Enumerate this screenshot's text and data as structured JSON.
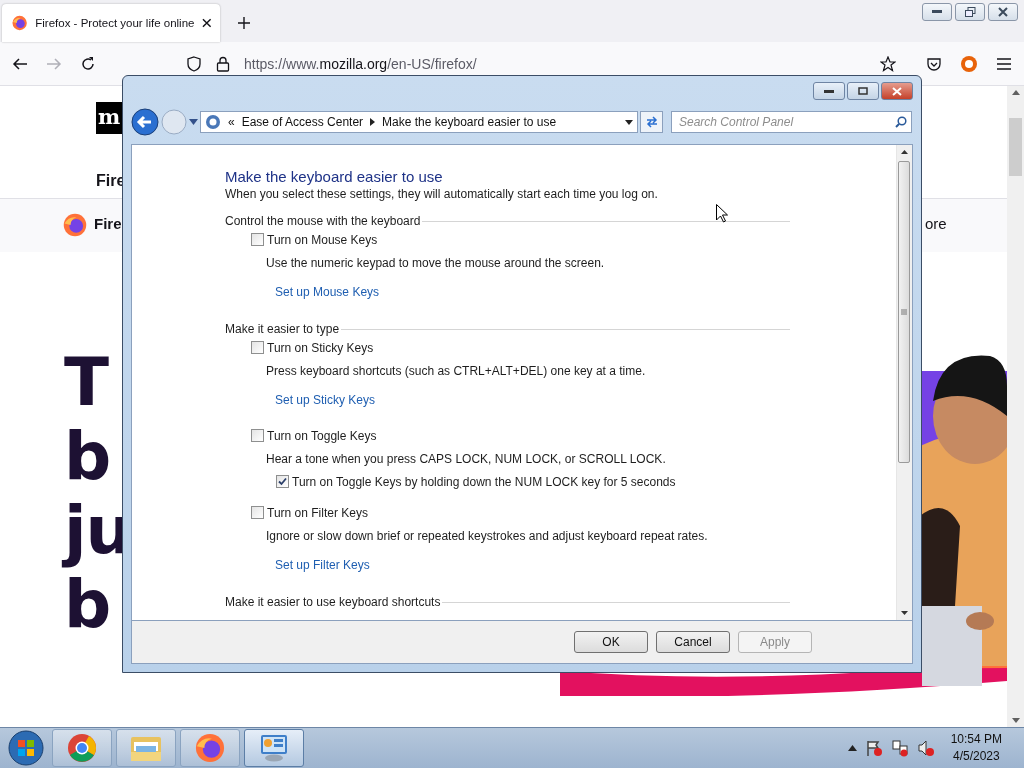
{
  "browser": {
    "tabs": [
      {
        "title": "Firefox - Protect your life online",
        "selected": true
      }
    ],
    "url_host": "https://www.",
    "url_domain": "mozilla.org",
    "url_path": "/en-US/firefox/"
  },
  "page": {
    "logo": "m",
    "nav_text": "Fire",
    "product_name": "Fire",
    "more_text": "ore",
    "headline": [
      "T",
      "b",
      "ju",
      "b"
    ]
  },
  "dialog": {
    "breadcrumb": [
      "«",
      "Ease of Access Center",
      "Make the keyboard easier to use"
    ],
    "search": {
      "placeholder": "Search Control Panel"
    },
    "title": "Make the keyboard easier to use",
    "subtitle": "When you select these settings, they will automatically start each time you log on.",
    "sections": [
      {
        "heading": "Control the mouse with the keyboard",
        "items": [
          {
            "kind": "checkbox",
            "label": "Turn on Mouse Keys",
            "checked": false
          },
          {
            "kind": "text",
            "label": "Use the numeric keypad to move the mouse around the screen."
          },
          {
            "kind": "link",
            "label": "Set up Mouse Keys"
          }
        ]
      },
      {
        "heading": "Make it easier to type",
        "items": [
          {
            "kind": "checkbox",
            "label": "Turn on Sticky Keys",
            "checked": false
          },
          {
            "kind": "text",
            "label": "Press keyboard shortcuts (such as CTRL+ALT+DEL) one key at a time."
          },
          {
            "kind": "link",
            "label": "Set up Sticky Keys"
          },
          {
            "kind": "checkbox",
            "label": "Turn on Toggle Keys",
            "checked": false
          },
          {
            "kind": "text",
            "label": "Hear a tone when you press CAPS LOCK, NUM LOCK, or SCROLL LOCK."
          },
          {
            "kind": "subcheckbox",
            "label": "Turn on Toggle Keys by holding down the NUM LOCK key for 5 seconds",
            "checked": true
          },
          {
            "kind": "checkbox",
            "label": "Turn on Filter Keys",
            "checked": false
          },
          {
            "kind": "text",
            "label": "Ignore or slow down brief or repeated keystrokes and adjust keyboard repeat rates."
          },
          {
            "kind": "link",
            "label": "Set up Filter Keys"
          }
        ]
      },
      {
        "heading": "Make it easier to use keyboard shortcuts"
      }
    ],
    "buttons": [
      {
        "label": "OK",
        "disabled": false
      },
      {
        "label": "Cancel",
        "disabled": false
      },
      {
        "label": "Apply",
        "disabled": true
      }
    ]
  },
  "taskbar": {
    "apps": [
      {
        "selected": false
      },
      {
        "selected": false
      },
      {
        "selected": false
      },
      {
        "selected": true
      }
    ],
    "time": "10:54 PM",
    "date": "4/5/2023"
  }
}
